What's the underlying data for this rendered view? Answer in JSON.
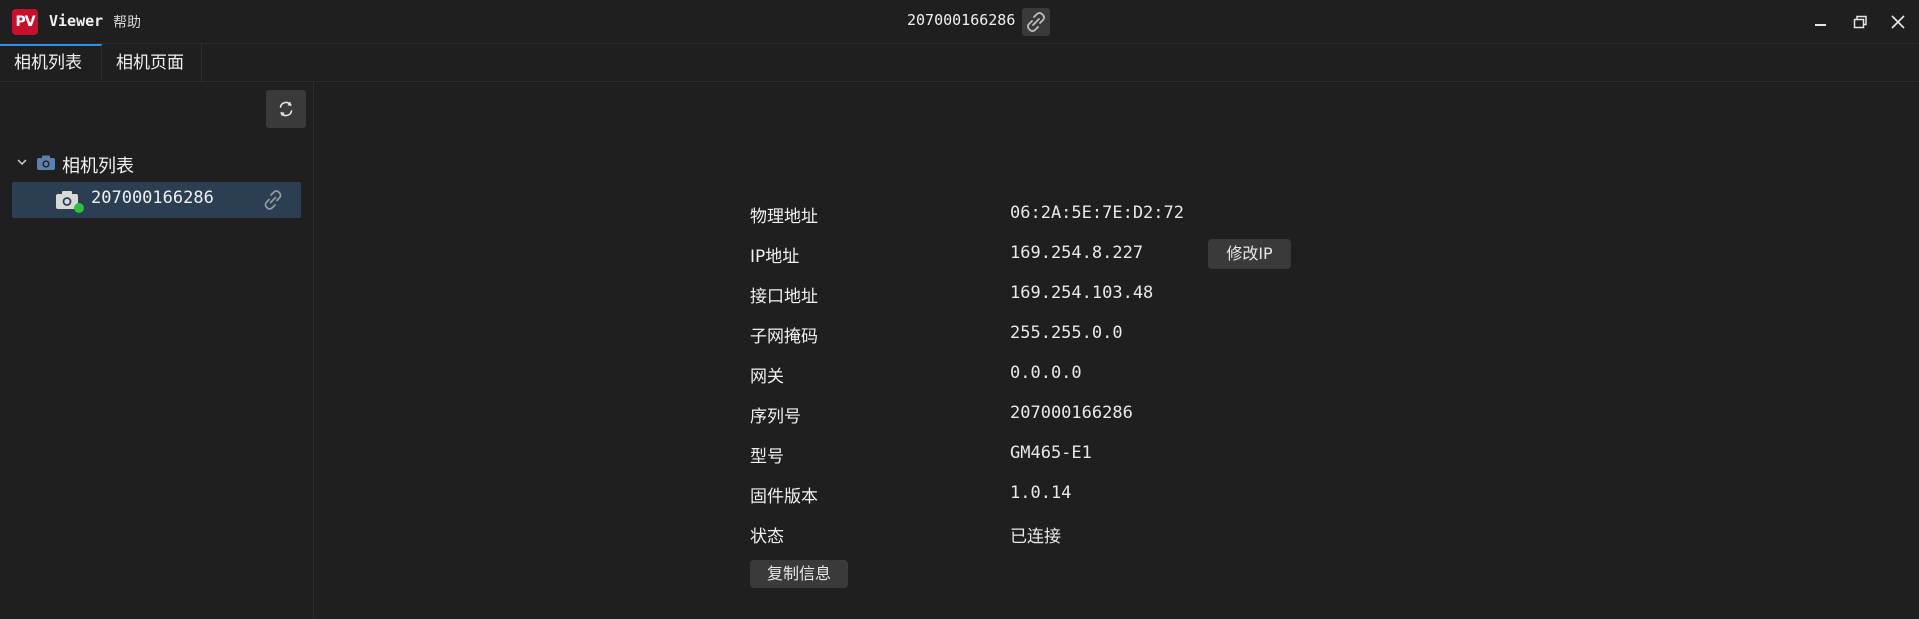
{
  "titlebar": {
    "logo_text": "PV",
    "app_name": "Viewer",
    "menu_help": "帮助",
    "device_title": "207000166286",
    "link_icon": "unlink-icon",
    "window_controls": [
      "minimize-icon",
      "restore-icon",
      "close-icon"
    ]
  },
  "tabs": [
    {
      "label": "相机列表",
      "active": true
    },
    {
      "label": "相机页面",
      "active": false
    }
  ],
  "sidebar": {
    "refresh_icon": "refresh-icon",
    "root_label": "相机列表",
    "items": [
      {
        "serial": "207000166286",
        "status": "online",
        "status_color": "#2fbf3a",
        "selected": true
      }
    ]
  },
  "info": {
    "rows": [
      {
        "label": "物理地址",
        "value": "06:2A:5E:7E:D2:72"
      },
      {
        "label": "IP地址",
        "value": "169.254.8.227"
      },
      {
        "label": "接口地址",
        "value": "169.254.103.48"
      },
      {
        "label": "子网掩码",
        "value": "255.255.0.0"
      },
      {
        "label": "网关",
        "value": "0.0.0.0"
      },
      {
        "label": "序列号",
        "value": "207000166286"
      },
      {
        "label": "型号",
        "value": "GM465-E1"
      },
      {
        "label": "固件版本",
        "value": "1.0.14"
      },
      {
        "label": "状态",
        "value": "已连接"
      }
    ],
    "modify_ip_label": "修改IP",
    "copy_info_label": "复制信息"
  },
  "colors": {
    "background": "#1f1f1f",
    "accent": "#2d8cf0",
    "selection": "#2c3e52",
    "brand": "#c8102e"
  }
}
